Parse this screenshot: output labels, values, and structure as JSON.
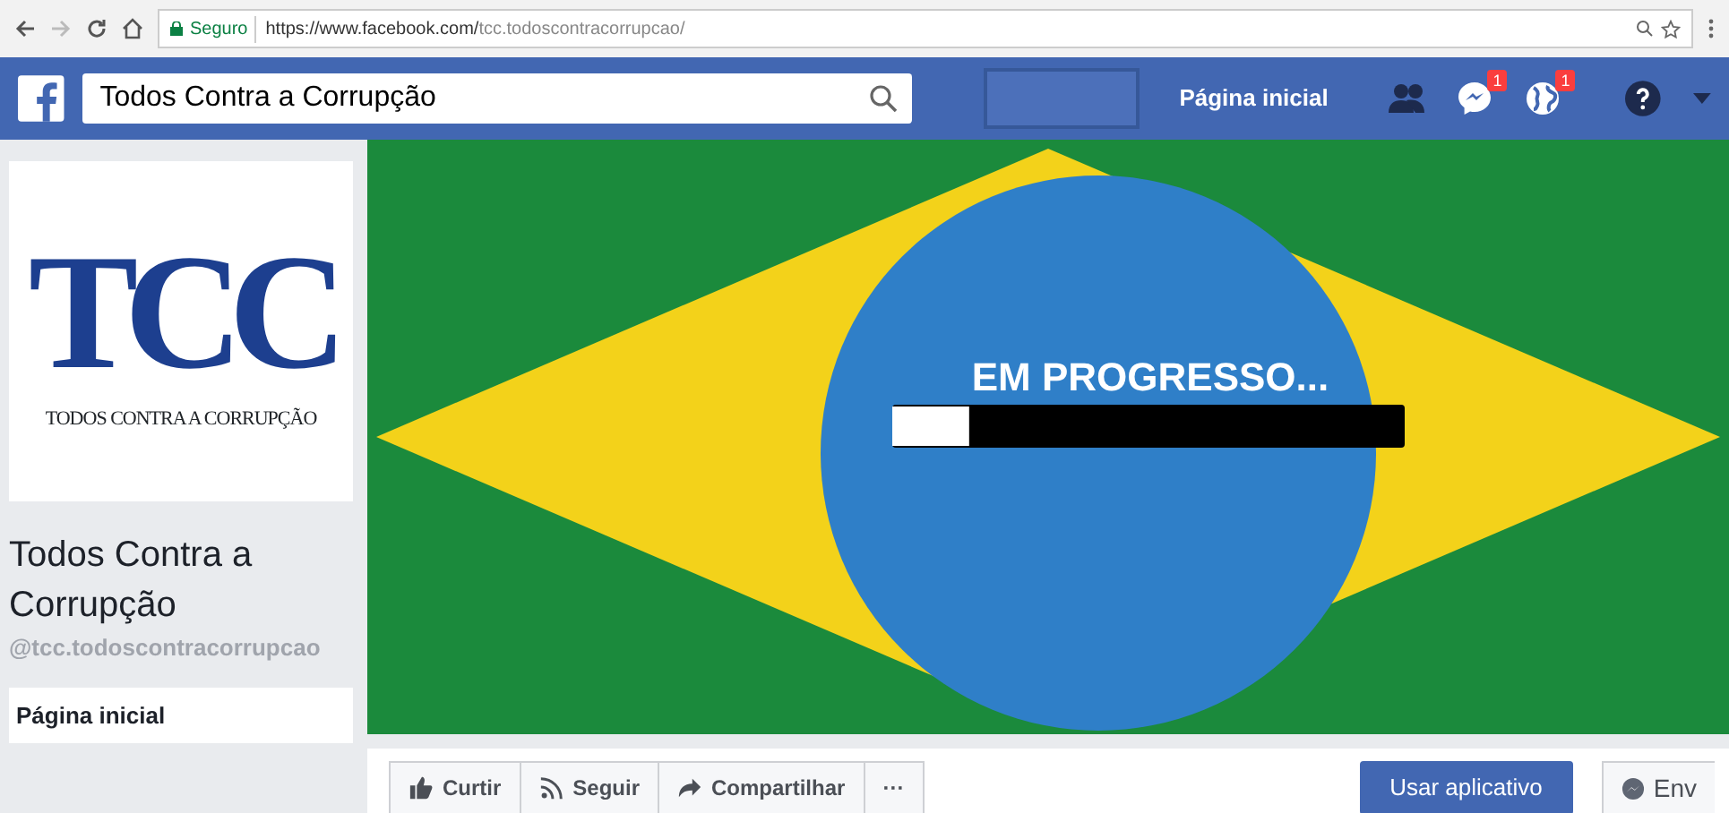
{
  "browser": {
    "secure_label": "Seguro",
    "url_host": "https://www.facebook.com/",
    "url_path": "tcc.todoscontracorrupcao/"
  },
  "header": {
    "search_value": "Todos Contra a Corrupção",
    "home_link": "Página inicial",
    "badges": [
      {
        "kind": "friends"
      },
      {
        "kind": "messages",
        "count": "1"
      },
      {
        "kind": "notifications",
        "count": "1"
      }
    ]
  },
  "profile": {
    "logo_letters": "TCC",
    "logo_caption": "TODOS CONTRA A CORRUPÇÃO",
    "name": "Todos Contra a Corrupção",
    "handle": "@tcc.todoscontracorrupcao"
  },
  "nav": [
    {
      "label": "Página inicial",
      "selected": true
    }
  ],
  "cover": {
    "text": "EM PROGRESSO...",
    "level": 0.15
  },
  "actions": [
    {
      "kind": "like",
      "label": "Curtir"
    },
    {
      "kind": "follow",
      "label": "Seguir"
    },
    {
      "kind": "share",
      "label": "Compartilhar"
    },
    {
      "kind": "more",
      "label": "···"
    }
  ],
  "primary_button": "Usar aplicativo",
  "message_button": "Env"
}
